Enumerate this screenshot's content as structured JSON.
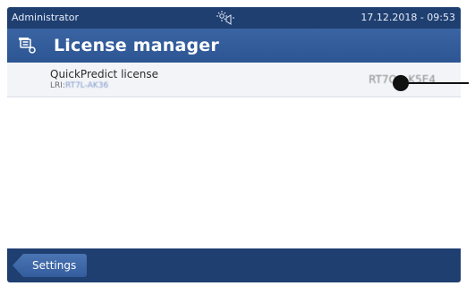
{
  "status_bar": {
    "user": "Administrator",
    "datetime": "17.12.2018 - 09:53",
    "icon": "leveling-status-icon"
  },
  "header": {
    "icon": "license-manager-icon",
    "title": "License manager"
  },
  "licenses": [
    {
      "title": "QuickPredict license",
      "sub_label": "LRI:",
      "sub_value": "RT7L-AK36",
      "value": "RT7QA-K5E4"
    }
  ],
  "footer": {
    "back_label": "Settings"
  },
  "colors": {
    "status_bar": "#1f3f71",
    "title_bar": "#2d5593",
    "row_background": "#f2f4f8"
  }
}
